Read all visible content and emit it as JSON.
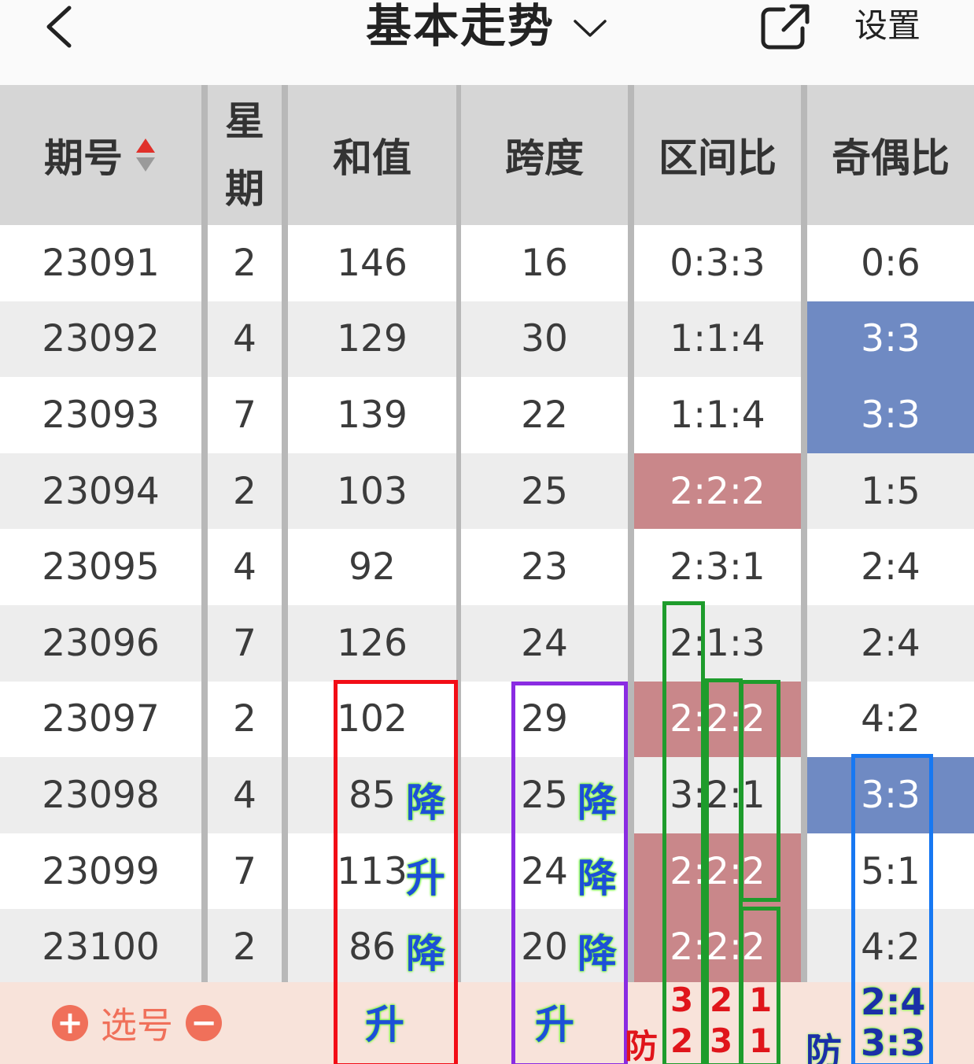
{
  "header": {
    "title": "基本走势",
    "settings_label": "设置",
    "icons": {
      "back": "back-chevron-icon",
      "dropdown": "chevron-down-icon",
      "share": "share-external-icon"
    }
  },
  "columns": {
    "issue": "期号",
    "weekday_top": "星",
    "weekday_bottom": "期",
    "sum": "和值",
    "span": "跨度",
    "zone_ratio": "区间比",
    "odd_even": "奇偶比"
  },
  "rows": [
    {
      "issue": "23091",
      "weekday": "2",
      "sum": "146",
      "span": "16",
      "zone": "0:3:3",
      "oddeven": "0:6",
      "zone_hl": false,
      "oe_hl": false
    },
    {
      "issue": "23092",
      "weekday": "4",
      "sum": "129",
      "span": "30",
      "zone": "1:1:4",
      "oddeven": "3:3",
      "zone_hl": false,
      "oe_hl": true
    },
    {
      "issue": "23093",
      "weekday": "7",
      "sum": "139",
      "span": "22",
      "zone": "1:1:4",
      "oddeven": "3:3",
      "zone_hl": false,
      "oe_hl": true
    },
    {
      "issue": "23094",
      "weekday": "2",
      "sum": "103",
      "span": "25",
      "zone": "2:2:2",
      "oddeven": "1:5",
      "zone_hl": true,
      "oe_hl": false
    },
    {
      "issue": "23095",
      "weekday": "4",
      "sum": "92",
      "span": "23",
      "zone": "2:3:1",
      "oddeven": "2:4",
      "zone_hl": false,
      "oe_hl": false
    },
    {
      "issue": "23096",
      "weekday": "7",
      "sum": "126",
      "span": "24",
      "zone": "2:1:3",
      "oddeven": "2:4",
      "zone_hl": false,
      "oe_hl": false
    },
    {
      "issue": "23097",
      "weekday": "2",
      "sum": "102",
      "span": "29",
      "zone": "2:2:2",
      "oddeven": "4:2",
      "zone_hl": true,
      "oe_hl": false
    },
    {
      "issue": "23098",
      "weekday": "4",
      "sum": "85",
      "span": "25",
      "zone": "3:2:1",
      "oddeven": "3:3",
      "zone_hl": false,
      "oe_hl": true
    },
    {
      "issue": "23099",
      "weekday": "7",
      "sum": "113",
      "span": "24",
      "zone": "2:2:2",
      "oddeven": "5:1",
      "zone_hl": true,
      "oe_hl": false
    },
    {
      "issue": "23100",
      "weekday": "2",
      "sum": "86",
      "span": "20",
      "zone": "2:2:2",
      "oddeven": "4:2",
      "zone_hl": true,
      "oe_hl": false
    }
  ],
  "footer": {
    "pick_label": "选号",
    "plus": "+",
    "minus": "−"
  },
  "annotations": {
    "sum_trend": [
      "降",
      "升",
      "降"
    ],
    "sum_forecast": "升",
    "span_trend": [
      "降",
      "降",
      "降"
    ],
    "span_forecast": "升",
    "zone_guard_label": "防",
    "zone_forecast_cols": [
      [
        "3",
        "2"
      ],
      [
        "2",
        "3"
      ],
      [
        "1",
        "1"
      ]
    ],
    "oe_guard_label": "防",
    "oe_forecast": [
      "2:4",
      "3:3"
    ]
  },
  "colors": {
    "row_alt": "#ededed",
    "header_bg": "#d6d6d6",
    "highlight_red": "#c9878a",
    "highlight_blue": "#6f8ac3",
    "footer_bg": "#f8e3da",
    "accent": "#f0705a"
  }
}
